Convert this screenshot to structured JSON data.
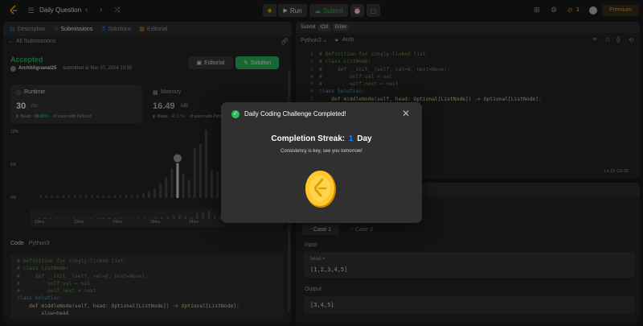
{
  "topbar": {
    "title": "Daily Question",
    "run_label": "Run",
    "submit_label": "Submit",
    "streak_count": "1",
    "premium_label": "Premium"
  },
  "left": {
    "tabs": [
      "Description",
      "Submissions",
      "Solutions",
      "Editorial"
    ],
    "back_label": "All Submissions",
    "status": "Accepted",
    "user": "ArchitAgrawal25",
    "submitted": "submitted at Mar 07, 2024 10:55",
    "editorial_btn": "Editorial",
    "solution_btn": "Solution",
    "runtime": {
      "label": "Runtime",
      "value": "30",
      "unit": "ms",
      "beats": "Beats",
      "pct": "86.81%",
      "rest": "of users with Python3"
    },
    "memory": {
      "label": "Memory",
      "value": "16.49",
      "unit": "MB",
      "beats": "Beats",
      "pct": "40.17%",
      "rest": "of users with Python3"
    },
    "chart_y": [
      "10%",
      "5%",
      "0%"
    ],
    "chart_x": [
      "10ms",
      "19ms",
      "24ms",
      "29ms",
      "34ms",
      "39ms"
    ],
    "code_header": "Code",
    "code_lang": "Python3",
    "code": [
      "# Definition for singly-linked list.",
      "# class ListNode:",
      "#     def __init__(self, val=0, next=None):",
      "#         self.val = val",
      "#         self.next = next",
      "class Solution:",
      "    def middleNode(self, head: Optional[ListNode]) -> Optional[ListNode]:",
      "        slow=head"
    ]
  },
  "editor": {
    "submit_hint": "Submit",
    "key1": "Ctrl",
    "key2": "Enter",
    "lang": "Python3",
    "auto": "Auto",
    "lines": [
      "# Definition for singly-linked list.",
      "# class ListNode:",
      "#     def __init__(self, val=0, next=None):",
      "#         self.val = val",
      "#         self.next = next",
      "class Solution:",
      "    def middleNode(self, head: Optional[ListNode]) -> Optional[ListNode]:"
    ],
    "line_numbers": [
      "1",
      "2",
      "3",
      "4",
      "5",
      "6",
      "7"
    ],
    "cursor": "Ln 10, Col 33"
  },
  "testcase": {
    "case1": "Case 1",
    "case2": "Case 2",
    "input_label": "Input",
    "var_label": "head =",
    "input_value": "[1,2,3,4,5]",
    "output_label": "Output",
    "output_value": "[3,4,5]"
  },
  "modal": {
    "title": "Daily Coding Challenge Completed!",
    "streak_label": "Completion Streak:",
    "streak_value": "1",
    "streak_unit": "Day",
    "message": "Consistency is key, see you tomorrow!"
  },
  "colors": {
    "accent_green": "#2cbb5d",
    "orange": "#ffa116",
    "blue": "#0a84ff",
    "modal_bg": "#303030"
  },
  "chart_data": {
    "type": "bar",
    "values": [
      0.4,
      0.4,
      0.4,
      0.4,
      0.4,
      0.4,
      0.4,
      0.4,
      0.4,
      0.4,
      0.4,
      0.4,
      0.4,
      0.4,
      0.4,
      0.5,
      0.5,
      0.6,
      0.8,
      1,
      1.5,
      2.2,
      3.2,
      4.5,
      5.3,
      3.7,
      2.8,
      7.6,
      8.2,
      10.3,
      4.2,
      4,
      6.3,
      3,
      1.8,
      1.5,
      3.8,
      2.8,
      2.4,
      1.4,
      1.9
    ],
    "highlight_index": 24
  }
}
